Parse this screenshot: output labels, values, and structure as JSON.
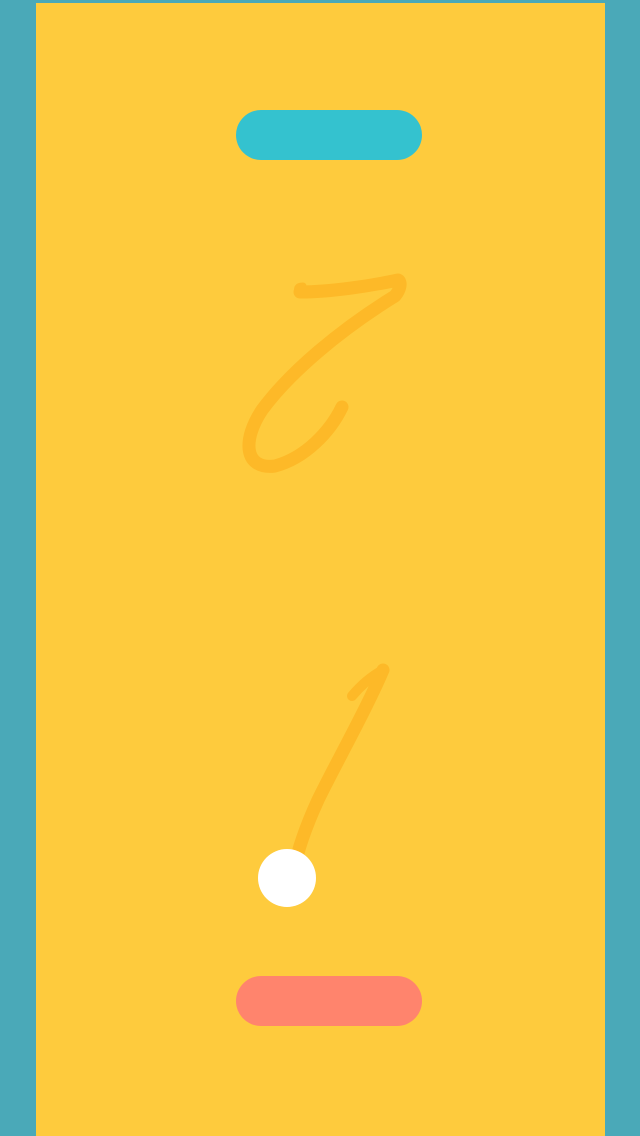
{
  "scores": {
    "opponent": "7",
    "player": "1"
  },
  "colors": {
    "background": "#4aa9b8",
    "field": "#fecb3d",
    "score": "#fdb928",
    "opponent_paddle": "#34c2cf",
    "player_paddle": "#ff846d",
    "ball": "#ffffff"
  }
}
